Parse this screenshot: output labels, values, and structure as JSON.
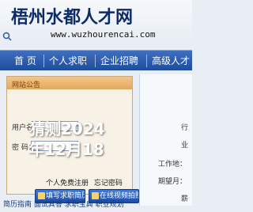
{
  "header": {
    "site_name": "梧州水都人才网",
    "url": "www.wuzhourencai.com"
  },
  "nav": {
    "items": [
      {
        "label": "首 页"
      },
      {
        "label": "个人求职"
      },
      {
        "label": "企业招聘"
      },
      {
        "label": "高级人才"
      }
    ]
  },
  "login": {
    "title": "网站公告",
    "username_label": "用户名：",
    "password_label": "密  码：",
    "register_link": "个人免费注册",
    "forgot_link": "忘记密码",
    "resume_button": "填写求职简历",
    "video_button": "在线视频拍照"
  },
  "footer": {
    "links": "简历指南  面试其答  求职宝典  职业规划"
  },
  "side": {
    "labels": [
      "行",
      "业",
      "工作地：",
      "期望月：",
      "薪"
    ]
  },
  "watermark": {
    "line1": "猜测2024",
    "line2": "年12月18"
  },
  "colors": {
    "nav_bg": "#2a5aae",
    "logo": "#0d2c66",
    "panel_head": "#e9b26a",
    "button": "#2b62c2"
  }
}
